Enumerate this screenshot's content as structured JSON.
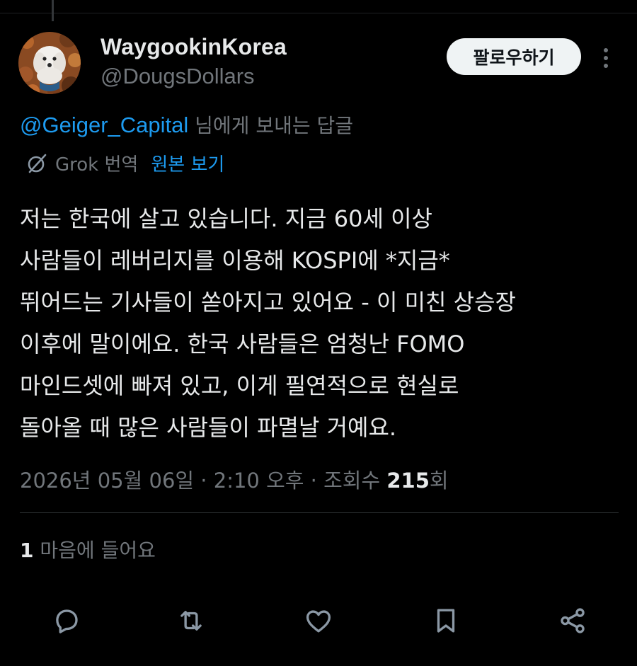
{
  "author": {
    "display_name": "WaygookinKorea",
    "handle": "@DougsDollars",
    "avatar": "white-dog-on-autumn-leaves"
  },
  "header": {
    "follow_label": "팔로우하기",
    "more_icon": "more-vertical-icon"
  },
  "reply_context": {
    "mention": "@Geiger_Capital",
    "suffix": " 님에게 보내는 답글"
  },
  "translation": {
    "icon": "grok-icon",
    "label": "Grok 번역",
    "show_original": "원본 보기"
  },
  "tweet": {
    "lines": [
      "저는 한국에 살고 있습니다. 지금 60세 이상",
      "사람들이 레버리지를 이용해 KOSPI에 *지금*",
      "뛰어드는 기사들이 쏟아지고 있어요 - 이 미친 상승장",
      "이후에 말이에요. 한국 사람들은 엄청난 FOMO",
      "마인드셋에 빠져 있고, 이게 필연적으로 현실로",
      "돌아올 때 많은 사람들이 파멸날 거예요."
    ]
  },
  "meta": {
    "date": "2026년 05월 06일",
    "separator": " · ",
    "time": "2:10 오후",
    "views_label": "조회수 ",
    "views_count": "215",
    "views_suffix": "회"
  },
  "likes": {
    "count": "1",
    "label": " 마음에 들어요"
  },
  "actions": [
    {
      "name": "reply",
      "icon": "reply-icon"
    },
    {
      "name": "repost",
      "icon": "repost-icon"
    },
    {
      "name": "like",
      "icon": "heart-icon"
    },
    {
      "name": "bookmark",
      "icon": "bookmark-icon"
    },
    {
      "name": "share",
      "icon": "share-icon"
    }
  ],
  "colors": {
    "background": "#000000",
    "text": "#e7e9ea",
    "secondary": "#71767b",
    "link": "#1d9bf0",
    "divider": "#2f3336"
  }
}
